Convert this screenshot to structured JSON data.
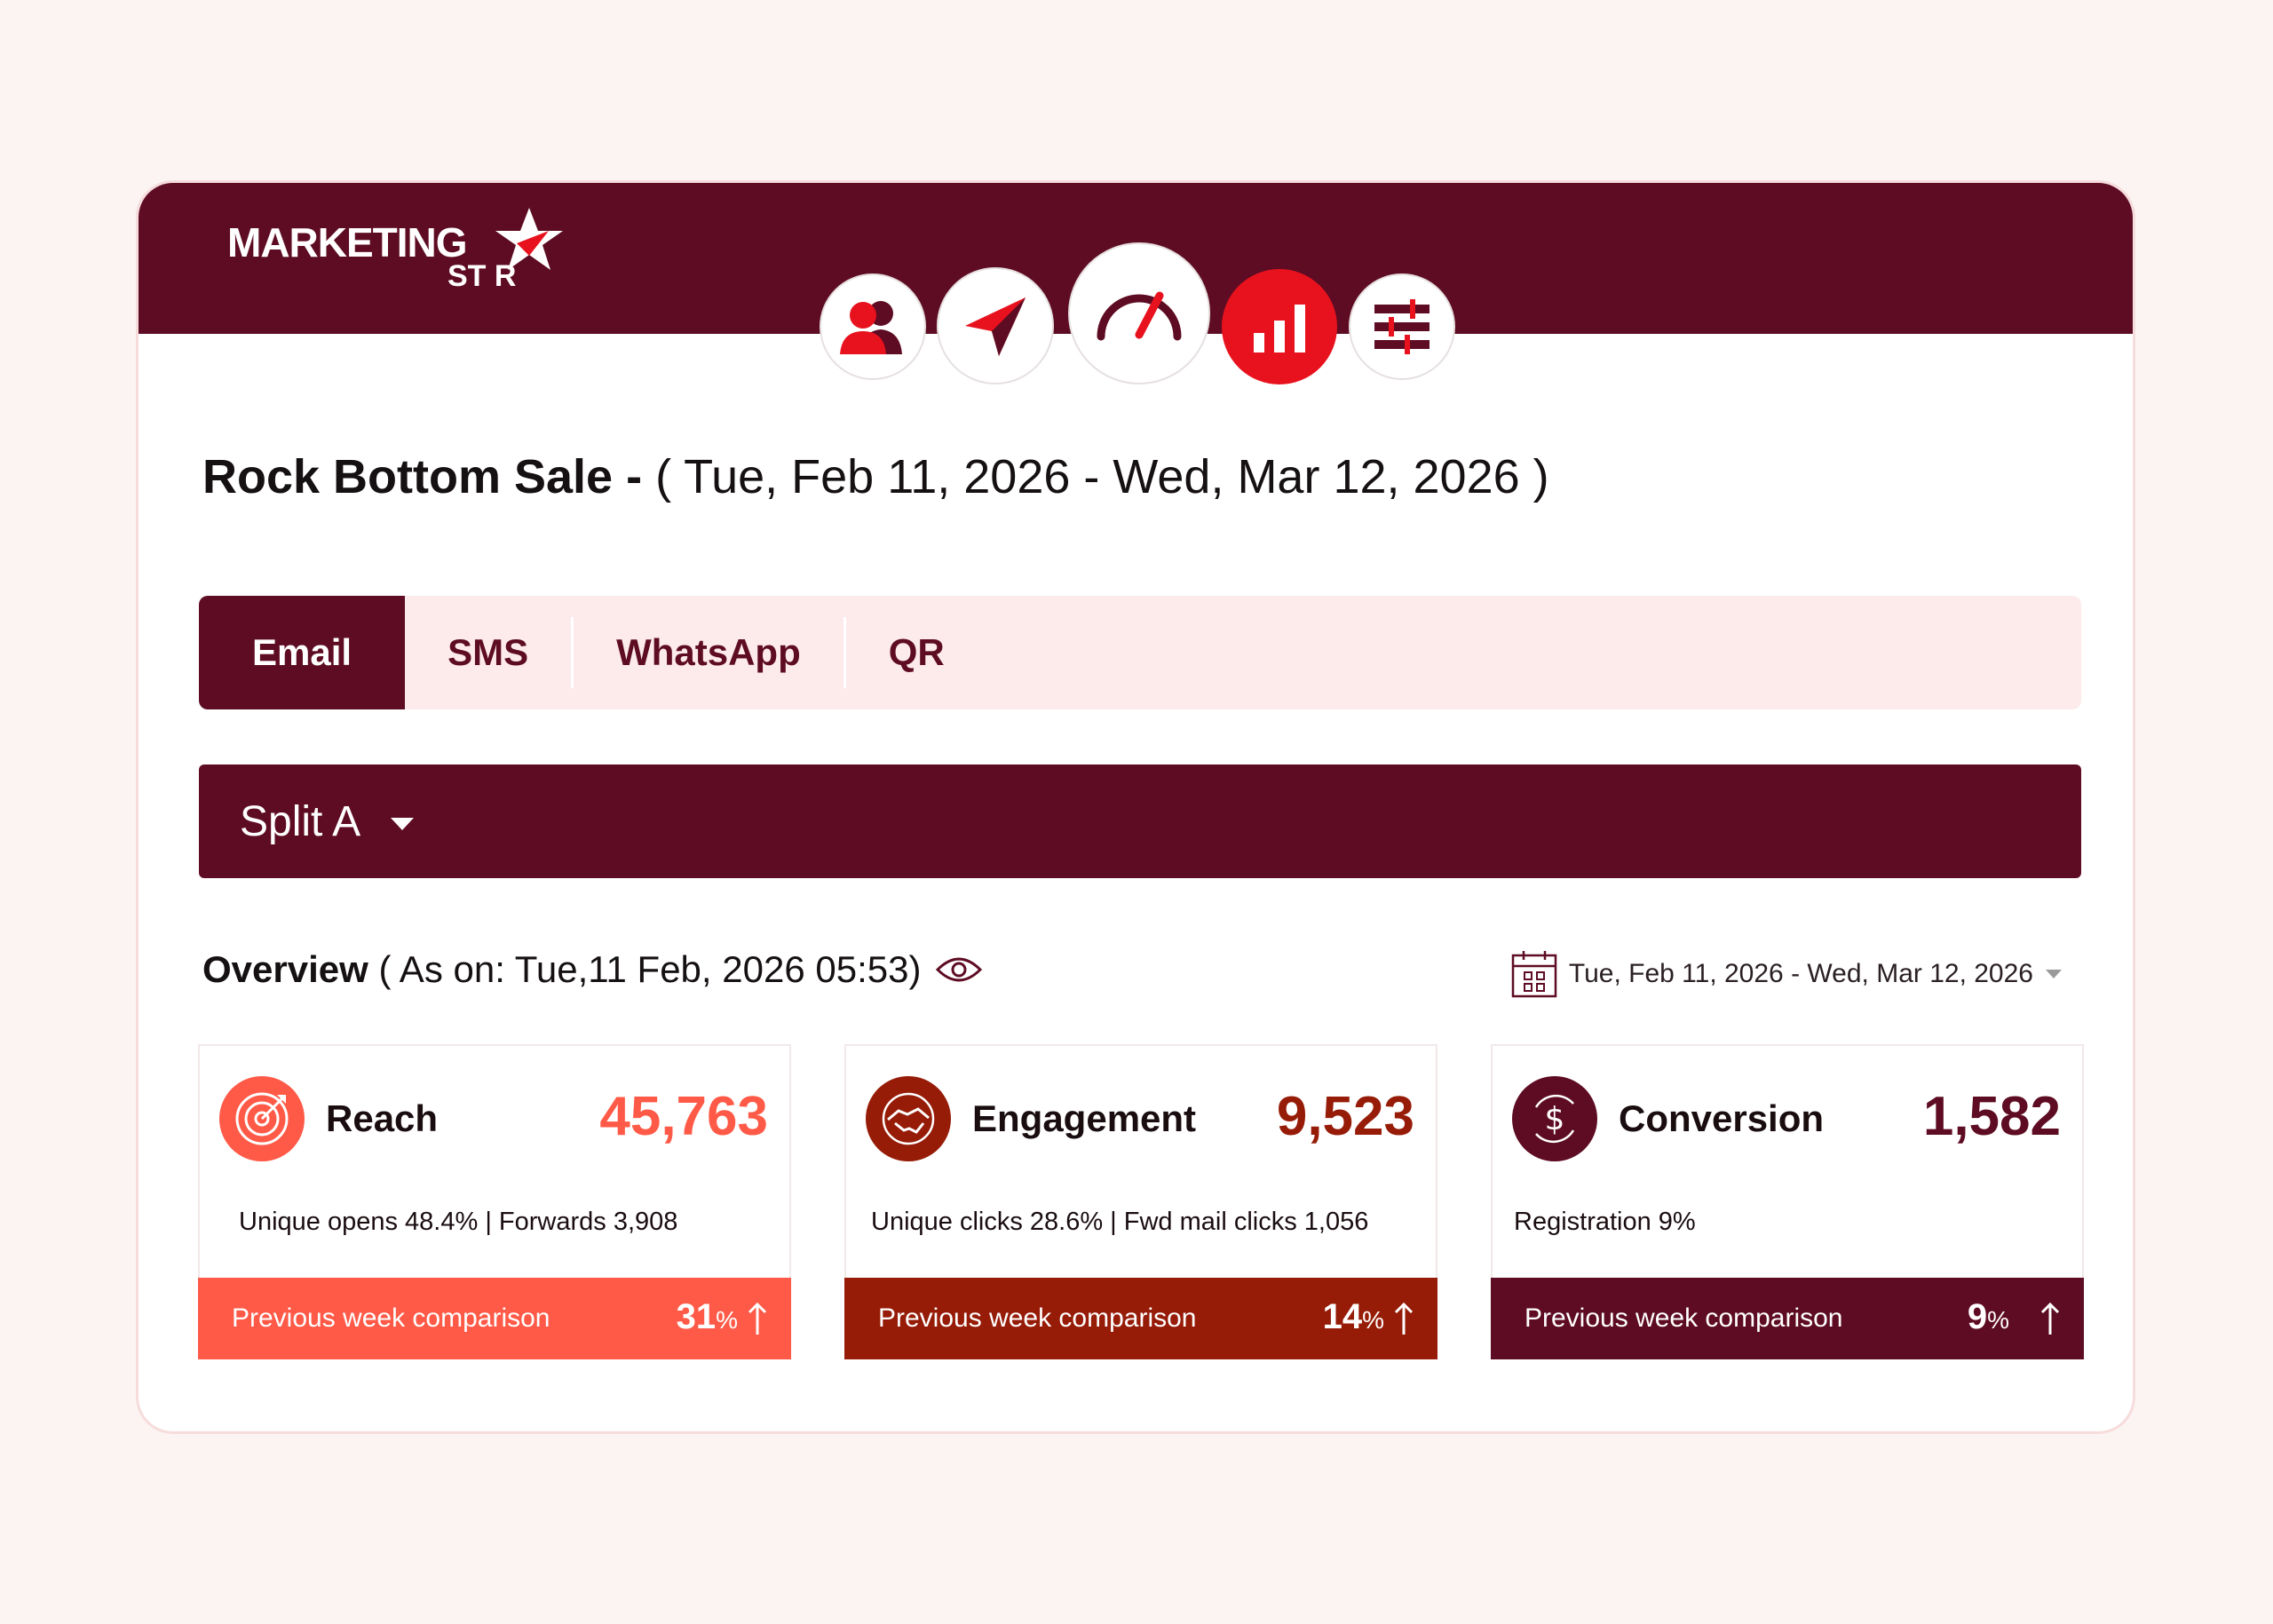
{
  "brand": {
    "line1": "MARKETING",
    "line2": "ST  R",
    "bar_color": "#5e0c23",
    "accent": "#e8121e"
  },
  "nav": {
    "items": [
      {
        "icon": "audience-icon",
        "active": false
      },
      {
        "icon": "send-icon",
        "active": false
      },
      {
        "icon": "speedometer-icon",
        "active": false
      },
      {
        "icon": "bar-chart-icon",
        "active": true
      },
      {
        "icon": "sliders-icon",
        "active": false
      }
    ]
  },
  "campaign": {
    "name": "Rock Bottom Sale -",
    "range": "( Tue, Feb 11, 2026 - Wed, Mar 12, 2026 )"
  },
  "tabs": [
    {
      "label": "Email",
      "active": true
    },
    {
      "label": "SMS",
      "active": false
    },
    {
      "label": "WhatsApp",
      "active": false
    },
    {
      "label": "QR",
      "active": false
    }
  ],
  "split": {
    "selected": "Split A"
  },
  "overview": {
    "label": "Overview",
    "as_on": "( As on: Tue,11 Feb, 2026 05:53)"
  },
  "date_filter": {
    "value": "Tue, Feb 11, 2026 - Wed, Mar 12, 2026"
  },
  "metrics": [
    {
      "name": "Reach",
      "value": "45,763",
      "sub": "Unique opens 48.4% | Forwards 3,908",
      "footer_label": "Previous week comparison",
      "change": "31",
      "change_unit": "%",
      "color": "#ff5a47",
      "icon": "target-icon"
    },
    {
      "name": "Engagement",
      "value": "9,523",
      "sub": "Unique clicks 28.6% | Fwd mail clicks 1,056",
      "footer_label": "Previous week comparison",
      "change": "14",
      "change_unit": "%",
      "color": "#961c08",
      "icon": "handshake-icon"
    },
    {
      "name": "Conversion",
      "value": "1,582",
      "sub": "Registration 9%",
      "footer_label": "Previous week comparison",
      "change": "9",
      "change_unit": "%",
      "color": "#5e0c23",
      "icon": "dollar-icon"
    }
  ]
}
